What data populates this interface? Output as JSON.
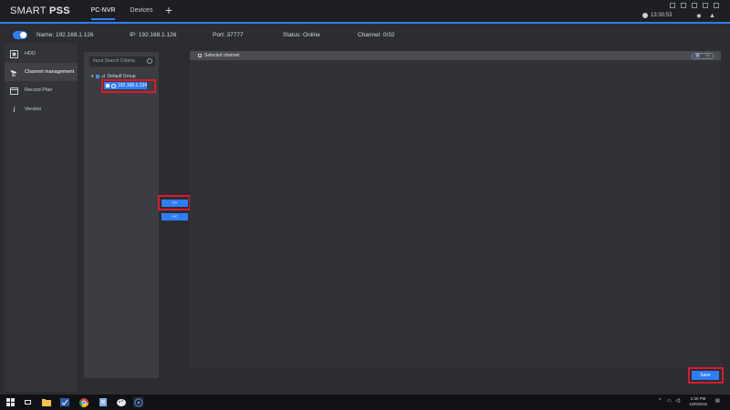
{
  "titlebar": {
    "brand_light": "SMART ",
    "brand_bold": "PSS",
    "tabs": [
      {
        "label": "PC-NVR"
      },
      {
        "label": "Devices"
      }
    ],
    "add_tab": "+",
    "clock": "13:30:53"
  },
  "device": {
    "name": "Name: 192.168.1.126",
    "ip": "IP: 192.168.1.126",
    "port": "Port: 37777",
    "status": "Status: Online",
    "channel": "Channel: 0/32"
  },
  "nav": {
    "items": [
      {
        "label": "HDD",
        "icon": "hdd-icon"
      },
      {
        "label": "Channel management",
        "icon": "camera-icon"
      },
      {
        "label": "Record Plan",
        "icon": "calendar-icon"
      },
      {
        "label": "Version",
        "icon": "info-icon"
      }
    ]
  },
  "tree": {
    "search_placeholder": "Input Search Criteria",
    "group": "Default Group",
    "device": "192.168.1.134"
  },
  "transfer": {
    "add": ">>",
    "remove": "<<"
  },
  "right_panel": {
    "title": "Selected channel"
  },
  "actions": {
    "save": "Save"
  },
  "taskbar": {
    "time": "1:30 PM",
    "date": "12/6/2016"
  },
  "colors": {
    "accent": "#2f7df6",
    "highlight": "#e0182b"
  }
}
